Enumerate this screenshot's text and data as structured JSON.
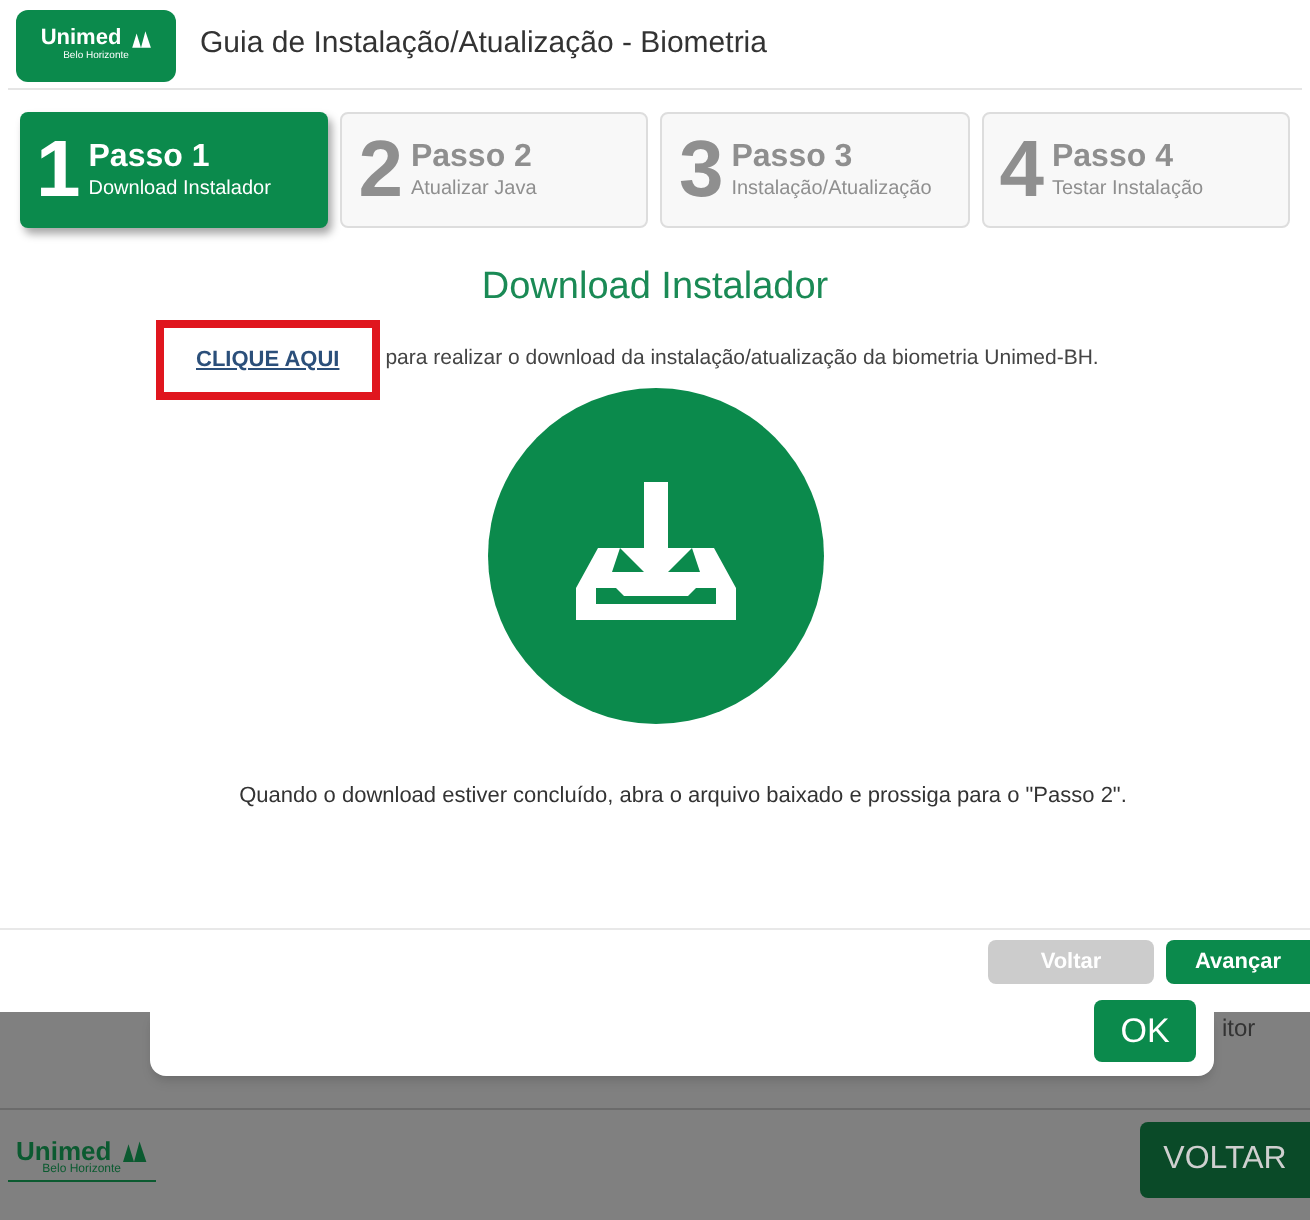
{
  "header": {
    "logo": {
      "name": "Unimed",
      "region": "Belo Horizonte"
    },
    "title": "Guia de Instalação/Atualização - Biometria"
  },
  "steps": [
    {
      "number": "1",
      "title": "Passo 1",
      "subtitle": "Download Instalador",
      "selected": true
    },
    {
      "number": "2",
      "title": "Passo 2",
      "subtitle": "Atualizar Java",
      "selected": false
    },
    {
      "number": "3",
      "title": "Passo 3",
      "subtitle": "Instalação/Atualização",
      "selected": false
    },
    {
      "number": "4",
      "title": "Passo 4",
      "subtitle": "Testar Instalação",
      "selected": false
    }
  ],
  "content": {
    "heading": "Download Instalador",
    "link": "CLIQUE AQUI",
    "link_highlighted": true,
    "link_text": "para realizar o download da instalação/atualização da biometria Unimed-BH.",
    "note": "Quando o download estiver concluído, abra o arquivo baixado e prossiga para o \"Passo 2\"."
  },
  "footer_buttons": [
    {
      "label": "Voltar",
      "disabled": true
    },
    {
      "label": "Avançar",
      "disabled": false
    }
  ],
  "background": {
    "dialog_button": "OK",
    "partial_text": "itor",
    "logo": {
      "name": "Unimed",
      "region": "Belo Horizonte"
    },
    "back_button": "VOLTAR"
  }
}
